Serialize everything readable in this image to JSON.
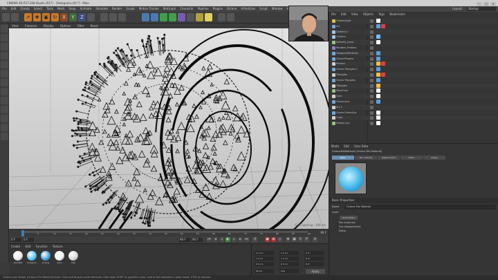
{
  "window": {
    "title": "CINEMA 4D R17.048 Studio (R17) - [Hologram.c4d *] - Main",
    "controls": [
      "–",
      "□",
      "×"
    ]
  },
  "menubar": {
    "items": [
      "File",
      "Edit",
      "Create",
      "Select",
      "Tools",
      "Mesh",
      "Snap",
      "Animate",
      "Simulate",
      "Render",
      "Sculpt",
      "Motion Tracker",
      "MoGraph",
      "Character",
      "Pipeline",
      "Plugins",
      "Octane",
      "X-Particles",
      "Script",
      "Window",
      "Help"
    ],
    "layout_label": "Layout:",
    "layout_value": "Startup"
  },
  "viewport": {
    "menu": [
      "View",
      "Cameras",
      "Display",
      "Options",
      "Filter",
      "Panel"
    ],
    "grid_spacing": "Grid Spacing : 100 cm"
  },
  "timeline": {
    "start": "0",
    "end": "90 F",
    "ticks": [
      "0",
      "5",
      "10",
      "15",
      "20",
      "25",
      "30",
      "35",
      "40",
      "45",
      "50",
      "55",
      "60",
      "65",
      "70",
      "75",
      "80",
      "85",
      "90"
    ]
  },
  "transport": {
    "current_frame": "0 F",
    "start_frame": "0 F",
    "end_frame": "90 F",
    "max_frame": "90 F"
  },
  "material_manager": {
    "menu": [
      "Create",
      "Edit",
      "Function",
      "Texture"
    ],
    "materials": [
      {
        "label": "PlainMat",
        "color": "#e8e8e8"
      },
      {
        "label": "Hologram",
        "color": "#4fc3f7"
      },
      {
        "label": "Octane",
        "color": "#3aa0d8"
      },
      {
        "label": "Glow",
        "color": "#f0f0f0"
      },
      {
        "label": "Mat",
        "color": "#d8d8d8"
      }
    ]
  },
  "coordinates": {
    "rows": [
      {
        "a": "X  0 cm",
        "b": "X  0 cm",
        "c": "H  0°"
      },
      {
        "a": "Y  0 cm",
        "b": "Y  0 cm",
        "c": "P  0°"
      },
      {
        "a": "Z  0 cm",
        "b": "Z  0 cm",
        "c": "B  0°"
      }
    ],
    "mode_a": "World",
    "mode_b": "Size",
    "apply_label": "Apply"
  },
  "status": {
    "text": "Octane Live Viewer [Octane Fire Material]   Scale: Click and drag to scale elements. Hold down SHIFT to quantize scale / add to the selection in point mode. CTRL to remove."
  },
  "object_manager": {
    "menu": [
      "File",
      "Edit",
      "View",
      "Objects",
      "Tags",
      "Bookmarks"
    ],
    "objects": [
      {
        "name": "OctaneLight",
        "icon_color": "#e0c040",
        "tags": [
          "#ffffff"
        ]
      },
      {
        "name": "Arc",
        "icon_color": "#6fa8dc",
        "tags": [
          "#5aa0e0",
          "#e04040"
        ]
      },
      {
        "name": "Camera.1",
        "icon_color": "#9fc5e8",
        "tags": []
      },
      {
        "name": "Camera",
        "icon_color": "#9fc5e8",
        "tags": [
          "#6fbfff"
        ]
      },
      {
        "name": "Spherify_Lines",
        "icon_color": "#93c47d",
        "tags": [
          "#ffffff"
        ]
      },
      {
        "name": "Random_Protons",
        "icon_color": "#8e7cc3",
        "tags": []
      },
      {
        "name": "HologramParticles",
        "icon_color": "#6fa8dc",
        "tags": [
          "#5aa0e0"
        ]
      },
      {
        "name": "Cloner.Protons",
        "icon_color": "#6fa8dc",
        "tags": [
          "#5aa0e0"
        ]
      },
      {
        "name": "Protons",
        "icon_color": "#cfcfcf",
        "tags": [
          "#f0c040",
          "#e04040"
        ]
      },
      {
        "name": "Cloner.Triangles.1",
        "icon_color": "#6fa8dc",
        "tags": [
          "#5aa0e0"
        ]
      },
      {
        "name": "Triangles",
        "icon_color": "#cfcfcf",
        "tags": [
          "#f0c040",
          "#e04040"
        ]
      },
      {
        "name": "Cloner.Triangles",
        "icon_color": "#6fa8dc",
        "tags": [
          "#5aa0e0"
        ]
      },
      {
        "name": "Triangles",
        "icon_color": "#cfcfcf",
        "tags": [
          "#f0c040"
        ]
      },
      {
        "name": "MeshCore",
        "icon_color": "#93c47d",
        "tags": [
          "#ffffff"
        ]
      },
      {
        "name": "Core",
        "icon_color": "#cfcfcf",
        "tags": [
          "#ffffff"
        ]
      },
      {
        "name": "Cloner.Arcs",
        "icon_color": "#6fa8dc",
        "tags": [
          "#5aa0e0"
        ]
      },
      {
        "name": "Arc.1",
        "icon_color": "#cfcfcf",
        "tags": []
      },
      {
        "name": "Cloner.OuterArcs",
        "icon_color": "#6fa8dc",
        "tags": [
          "#ffffff"
        ]
      },
      {
        "name": "Cube",
        "icon_color": "#cfcfcf",
        "tags": [
          "#ffffff"
        ]
      },
      {
        "name": "Sweep.Cup",
        "icon_color": "#93c47d",
        "tags": [
          "#ffffff"
        ]
      }
    ]
  },
  "attribute_manager": {
    "menu": [
      "Mode",
      "Edit",
      "User Data"
    ],
    "title": "OctaneMatMaterial [Octane Mix Material]",
    "tabs": [
      "Basic",
      "Mix material",
      "Displacement",
      "Editor",
      "Assign"
    ],
    "active_tab": "Basic",
    "base_properties": "Basic Properties",
    "name_label": "Name",
    "name_value": "Octane Mix Material",
    "layer_label": "Layer",
    "show_editor_label": "Show Editor",
    "checks": [
      {
        "label": "Mix materials",
        "checked": true
      },
      {
        "label": "Use displacement",
        "checked": true
      },
      {
        "label": "Editor",
        "checked": true
      }
    ]
  }
}
